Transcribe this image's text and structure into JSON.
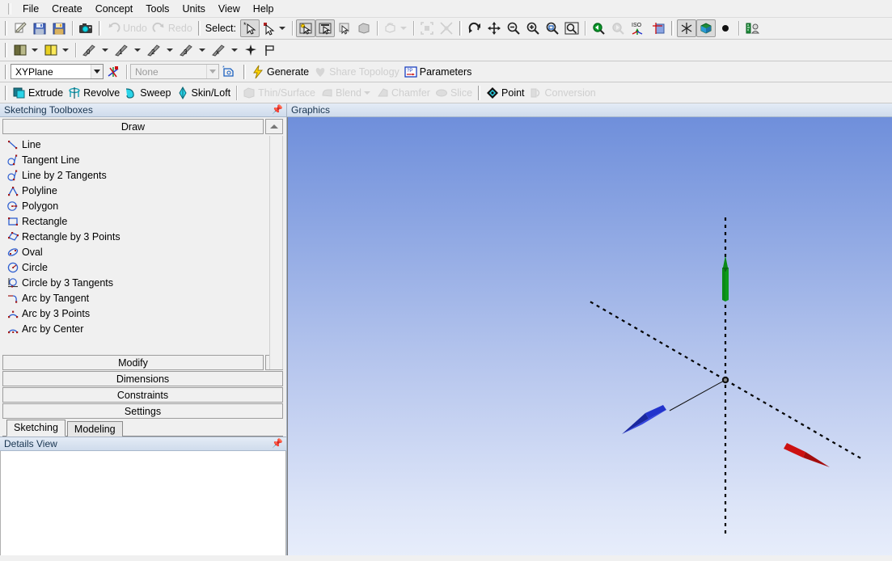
{
  "menubar": {
    "items": [
      {
        "label": "File"
      },
      {
        "label": "Create"
      },
      {
        "label": "Concept"
      },
      {
        "label": "Tools"
      },
      {
        "label": "Units"
      },
      {
        "label": "View"
      },
      {
        "label": "Help"
      }
    ]
  },
  "toolbar_main": {
    "new_icon": "new-document-icon",
    "save_icon": "save-icon",
    "save_as_icon": "save-as-icon",
    "screenshot_icon": "camera-icon",
    "undo_label": "Undo",
    "undo_icon": "undo-arrow-icon",
    "redo_label": "Redo",
    "redo_icon": "redo-arrow-icon",
    "select_label": "Select:",
    "select_single_icon": "select-single-cursor-icon",
    "select_mode_icon": "select-mode-cursor-icon",
    "select_box_icon": "box-select-icon",
    "select_frame_icon": "frame-select-icon",
    "select_face_icon": "face-select-icon",
    "select_body_icon": "body-select-icon",
    "hide_body_icon": "hide-body-icon",
    "extend_selection_icon": "extend-selection-icon",
    "extend_limits_icon": "extend-limits-icon",
    "rotate_icon": "rotate-view-icon",
    "pan_icon": "pan-icon",
    "zoom_out_icon": "zoom-out-icon",
    "zoom_in_icon": "zoom-in-icon",
    "box_zoom_icon": "box-zoom-icon",
    "zoom_to_fit_icon": "zoom-to-fit-icon",
    "previous_view_icon": "previous-view-icon",
    "next_view_icon": "next-view-icon",
    "iso_view_icon": "iso-view-icon",
    "look_at_icon": "look-at-face-icon",
    "display_plane_icon": "display-plane-icon",
    "display_model_icon": "display-model-icon",
    "display_points_icon": "display-points-icon",
    "ruler_icon": "ruler-icon"
  },
  "toolbar_plane": {
    "plane_icon": "new-plane-icon",
    "sketch_icon": "new-sketch-icon",
    "axis0_icon": "axis-0-icon",
    "axis1_icon": "axis-1-icon",
    "axis2_icon": "axis-2-icon",
    "axis3_icon": "axis-3-icon",
    "axisx_icon": "axis-x-icon",
    "star_icon": "point-star-icon",
    "flag_icon": "flag-icon"
  },
  "toolbar_sketch": {
    "plane_value": "XYPlane",
    "new_sketch_icon": "new-sketch-triad-icon",
    "sketch_value": "None",
    "edit_sketch_icon": "edit-sketch-icon",
    "generate_label": "Generate",
    "generate_icon": "lightning-bolt-icon",
    "share_topology_label": "Share Topology",
    "share_topology_icon": "heart-icon",
    "parameters_label": "Parameters",
    "parameters_icon": "parameters-icon"
  },
  "toolbar_model": {
    "items": [
      {
        "label": "Extrude",
        "icon": "extrude-icon",
        "enabled": true
      },
      {
        "label": "Revolve",
        "icon": "revolve-icon",
        "enabled": true
      },
      {
        "label": "Sweep",
        "icon": "sweep-icon",
        "enabled": true
      },
      {
        "label": "Skin/Loft",
        "icon": "skin-loft-icon",
        "enabled": true
      },
      {
        "label": "Thin/Surface",
        "icon": "thin-surface-icon",
        "enabled": false
      },
      {
        "label": "Blend",
        "icon": "blend-icon",
        "enabled": false,
        "dropdown": true
      },
      {
        "label": "Chamfer",
        "icon": "chamfer-icon",
        "enabled": false
      },
      {
        "label": "Slice",
        "icon": "slice-icon",
        "enabled": false
      },
      {
        "label": "Point",
        "icon": "point-icon",
        "enabled": true
      },
      {
        "label": "Conversion",
        "icon": "conversion-icon",
        "enabled": false
      }
    ]
  },
  "sketching_panel": {
    "title": "Sketching Toolboxes",
    "pin_icon": "pin-icon",
    "sections": {
      "draw": {
        "label": "Draw",
        "expanded": true,
        "spinner_icon": "chevron-up-icon"
      },
      "modify": {
        "label": "Modify",
        "expanded": false,
        "spinner_icon": "chevron-down-icon"
      },
      "dimensions": {
        "label": "Dimensions",
        "expanded": false
      },
      "constraints": {
        "label": "Constraints",
        "expanded": false
      },
      "settings": {
        "label": "Settings",
        "expanded": false
      }
    },
    "draw_tools": [
      {
        "label": "Line",
        "icon": "line-icon"
      },
      {
        "label": "Tangent Line",
        "icon": "tangent-line-icon"
      },
      {
        "label": "Line by 2 Tangents",
        "icon": "line-by-2-tangents-icon"
      },
      {
        "label": "Polyline",
        "icon": "polyline-icon"
      },
      {
        "label": "Polygon",
        "icon": "polygon-icon"
      },
      {
        "label": "Rectangle",
        "icon": "rectangle-icon"
      },
      {
        "label": "Rectangle by 3 Points",
        "icon": "rectangle-by-3-points-icon"
      },
      {
        "label": "Oval",
        "icon": "oval-icon"
      },
      {
        "label": "Circle",
        "icon": "circle-icon"
      },
      {
        "label": "Circle by 3 Tangents",
        "icon": "circle-by-3-tangents-icon"
      },
      {
        "label": "Arc by Tangent",
        "icon": "arc-by-tangent-icon"
      },
      {
        "label": "Arc by 3 Points",
        "icon": "arc-by-3-points-icon"
      },
      {
        "label": "Arc by Center",
        "icon": "arc-by-center-icon"
      }
    ],
    "tabs": [
      {
        "label": "Sketching",
        "active": true
      },
      {
        "label": "Modeling",
        "active": false
      }
    ]
  },
  "details_panel": {
    "title": "Details View",
    "pin_icon": "pin-icon"
  },
  "graphics_panel": {
    "title": "Graphics",
    "triad": {
      "x_axis_color": "#cc1111",
      "y_axis_color": "#0a8a17",
      "z_axis_color": "#2233cc",
      "axis_line_color": "#000000",
      "origin_label": "",
      "background_top_color": "#6f8fdb",
      "background_bottom_color": "#e8eefb"
    }
  }
}
